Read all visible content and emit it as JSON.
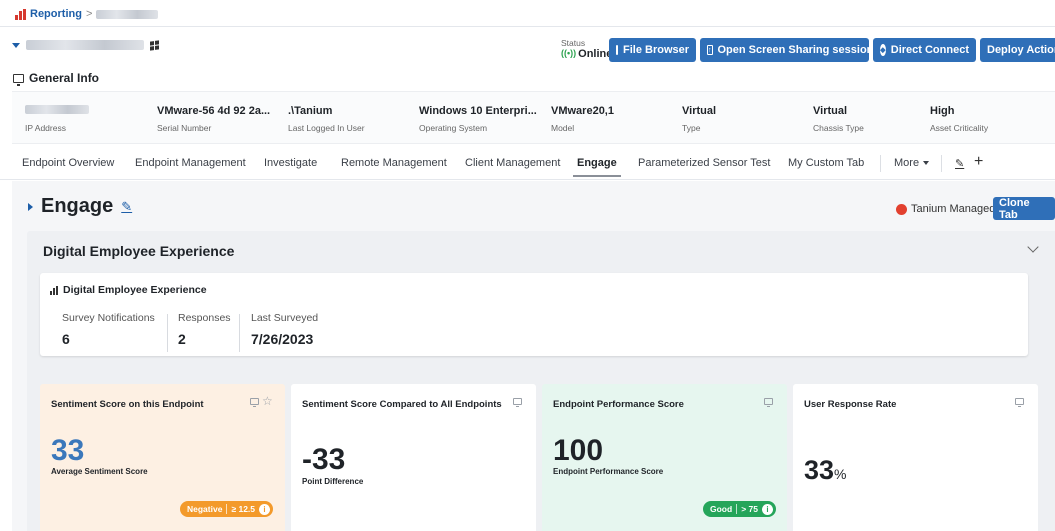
{
  "breadcrumb": {
    "root": "Reporting",
    "separator": ">"
  },
  "endpoint": {
    "status_label": "Status",
    "status_value": "Online"
  },
  "actions": {
    "file_browser": "File Browser",
    "screen_sharing": "Open Screen Sharing session",
    "direct_connect": "Direct Connect",
    "deploy_action": "Deploy Action"
  },
  "general_info": {
    "title": "General Info",
    "items": [
      {
        "value": "",
        "label": "IP Address"
      },
      {
        "value": "VMware-56 4d 92 2a...",
        "label": "Serial Number"
      },
      {
        "value": ".\\Tanium",
        "label": "Last Logged In User"
      },
      {
        "value": "Windows 10 Enterpri...",
        "label": "Operating System"
      },
      {
        "value": "VMware20,1",
        "label": "Model"
      },
      {
        "value": "Virtual",
        "label": "Type"
      },
      {
        "value": "Virtual",
        "label": "Chassis Type"
      },
      {
        "value": "High",
        "label": "Asset Criticality"
      }
    ]
  },
  "tabs": [
    "Endpoint Overview",
    "Endpoint Management",
    "Investigate",
    "Remote Management",
    "Client Management",
    "Engage",
    "Parameterized Sensor Test",
    "My Custom Tab",
    "More"
  ],
  "active_tab": "Engage",
  "page": {
    "title": "Engage",
    "managed_label": "Tanium Managed",
    "clone_tab": "Clone Tab"
  },
  "panel": {
    "title": "Digital Employee Experience",
    "survey": {
      "heading": "Digital Employee Experience",
      "stats": [
        {
          "label": "Survey Notifications",
          "value": "6"
        },
        {
          "label": "Responses",
          "value": "2"
        },
        {
          "label": "Last Surveyed",
          "value": "7/26/2023"
        }
      ]
    },
    "metrics": [
      {
        "title": "Sentiment Score on this Endpoint",
        "value": "33",
        "subtitle": "Average Sentiment Score",
        "pill_status": "Negative",
        "pill_threshold": "≥ 12.5"
      },
      {
        "title": "Sentiment Score Compared to All Endpoints",
        "value": "-33",
        "subtitle": "Point Difference"
      },
      {
        "title": "Endpoint Performance Score",
        "value": "100",
        "subtitle": "Endpoint Performance Score",
        "pill_status": "Good",
        "pill_threshold": "> 75"
      },
      {
        "title": "User Response Rate",
        "value": "33",
        "unit": "%"
      }
    ]
  },
  "colors": {
    "accent_blue": "#2f6fb8",
    "negative_orange": "#f39a2b",
    "good_green": "#25a55a",
    "sentiment_bg": "#fdf0e3",
    "performance_bg": "#e6f6ef"
  }
}
